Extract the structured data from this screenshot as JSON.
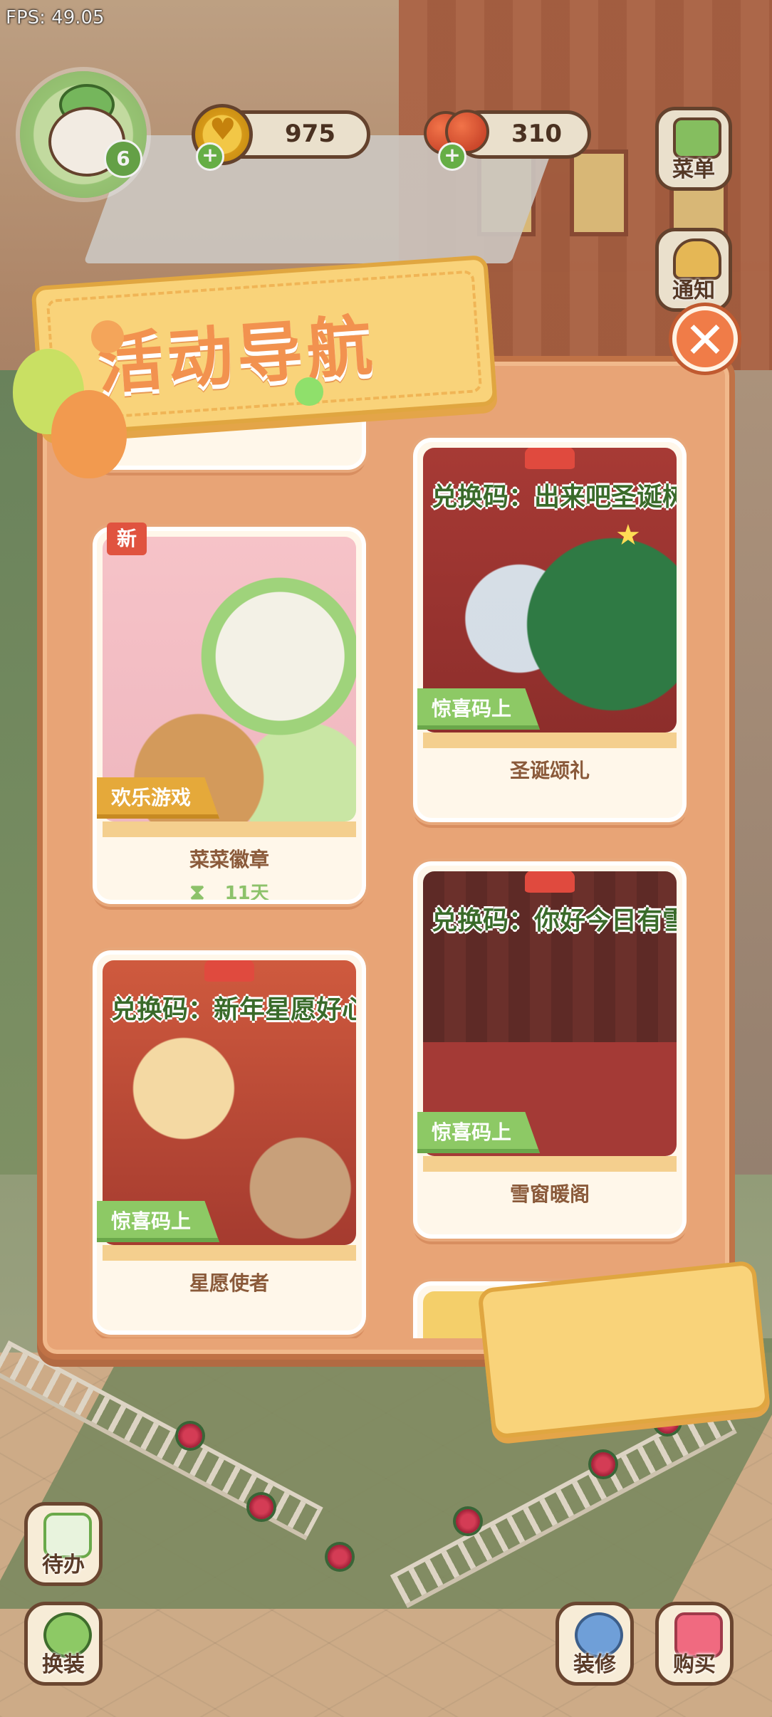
{
  "hud": {
    "fps": "FPS: 49.05",
    "level": "6",
    "coins": "975",
    "berries": "310",
    "menu_label": "菜单",
    "notice_label": "通知"
  },
  "modal": {
    "title": "活动导航",
    "close_icon": "close-x",
    "cards": [
      {
        "title": "菜菜徽章",
        "tag": "欢乐游戏",
        "badge": "新",
        "timer": "11天",
        "caption": ""
      },
      {
        "title": "圣诞颂礼",
        "tag": "惊喜码上",
        "caption": "兑换码：出来吧圣诞树"
      },
      {
        "title": "雪窗暖阁",
        "tag": "惊喜码上",
        "caption": "兑换码：你好今日有雪"
      },
      {
        "title": "星愿使者",
        "tag": "惊喜码上",
        "caption": "兑换码：新年星愿好心情"
      }
    ]
  },
  "bottom_bar": {
    "todo_label": "待办",
    "outfit_label": "换装",
    "decorate_label": "装修",
    "shop_label": "购买"
  },
  "colors": {
    "panel": "#e8a476",
    "tag_green": "#8dc965",
    "tag_gold": "#e5a93a",
    "title_orange": "#f2924f"
  }
}
